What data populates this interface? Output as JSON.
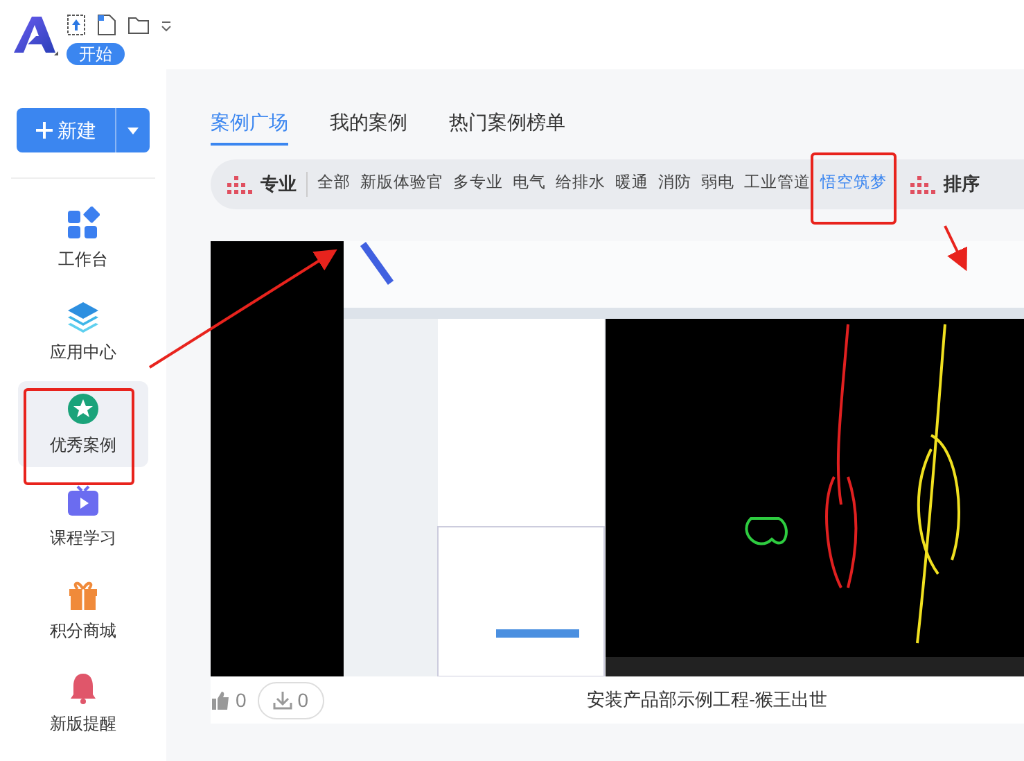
{
  "header": {
    "start_badge": "开始"
  },
  "sidebar": {
    "new_button": "新建",
    "items": [
      {
        "label": "工作台",
        "selected": false
      },
      {
        "label": "应用中心",
        "selected": false
      },
      {
        "label": "优秀案例",
        "selected": true
      },
      {
        "label": "课程学习",
        "selected": false
      },
      {
        "label": "积分商城",
        "selected": false
      },
      {
        "label": "新版提醒",
        "selected": false
      }
    ]
  },
  "tabs": [
    {
      "label": "案例广场",
      "selected": true
    },
    {
      "label": "我的案例",
      "selected": false
    },
    {
      "label": "热门案例榜单",
      "selected": false
    }
  ],
  "filter": {
    "label": "专业",
    "items": [
      {
        "label": "全部",
        "selected": false
      },
      {
        "label": "新版体验官",
        "selected": false
      },
      {
        "label": "多专业",
        "selected": false
      },
      {
        "label": "电气",
        "selected": false
      },
      {
        "label": "给排水",
        "selected": false
      },
      {
        "label": "暖通",
        "selected": false
      },
      {
        "label": "消防",
        "selected": false
      },
      {
        "label": "弱电",
        "selected": false
      },
      {
        "label": "工业管道",
        "selected": false
      },
      {
        "label": "悟空筑梦",
        "selected": true
      }
    ],
    "sort_label": "排序"
  },
  "case": {
    "likes": "0",
    "downloads": "0",
    "title": "安装产品部示例工程-猴王出世"
  }
}
